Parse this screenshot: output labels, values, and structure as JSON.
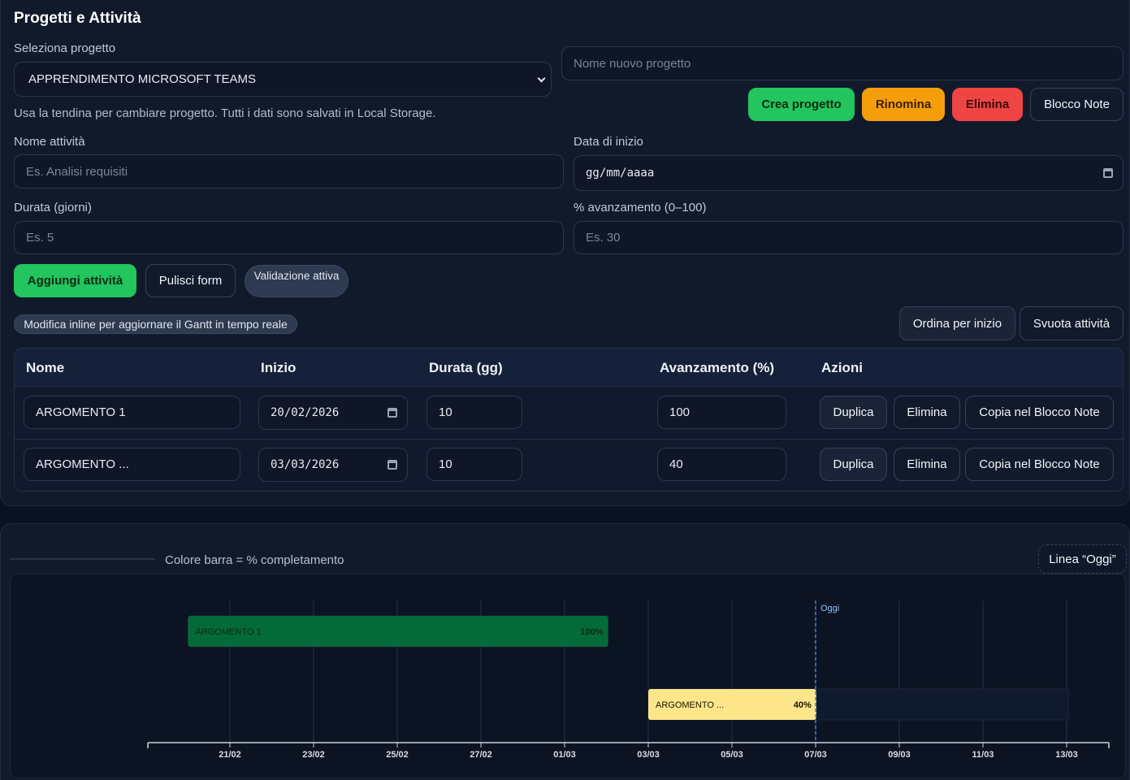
{
  "header": {
    "title": "Progetti e Attività"
  },
  "project": {
    "select_label": "Seleziona progetto",
    "selected": "APPRENDIMENTO MICROSOFT TEAMS",
    "new_name_placeholder": "Nome nuovo progetto",
    "hint": "Usa la tendina per cambiare progetto. Tutti i dati sono salvati in Local Storage.",
    "buttons": {
      "create": "Crea progetto",
      "rename": "Rinomina",
      "delete": "Elimina",
      "notes": "Blocco Note"
    }
  },
  "form": {
    "name_label": "Nome attività",
    "name_placeholder": "Es. Analisi requisiti",
    "start_label": "Data di inizio",
    "start_placeholder": "gg/mm/aaaa",
    "duration_label": "Durata (giorni)",
    "duration_placeholder": "Es. 5",
    "progress_label": "% avanzamento (0–100)",
    "progress_placeholder": "Es. 30",
    "add_button": "Aggiungi attività",
    "clear_button": "Pulisci form",
    "validation_badge": "Validazione attiva"
  },
  "toolbar": {
    "inline_hint": "Modifica inline per aggiornare il Gantt in tempo reale",
    "sort_button": "Ordina per inizio",
    "clear_tasks_button": "Svuota attività"
  },
  "table": {
    "columns": [
      "Nome",
      "Inizio",
      "Durata (gg)",
      "Avanzamento (%)",
      "Azioni"
    ],
    "rows": [
      {
        "name": "ARGOMENTO 1",
        "start": "20/02/2026",
        "duration": "10",
        "progress": "100"
      },
      {
        "name": "ARGOMENTO ...",
        "start": "03/03/2026",
        "duration": "10",
        "progress": "40"
      }
    ],
    "actions": {
      "duplicate": "Duplica",
      "delete": "Elimina",
      "copy_notes": "Copia nel Blocco Note"
    }
  },
  "gantt": {
    "legend_text": "Colore barra = % completamento",
    "today_button": "Linea “Oggi”",
    "today_label": "Oggi"
  },
  "chart_data": {
    "type": "gantt",
    "x_ticks": [
      "21/02",
      "23/02",
      "25/02",
      "27/02",
      "01/03",
      "03/03",
      "05/03",
      "07/03",
      "09/03",
      "11/03",
      "13/03"
    ],
    "today": "07/03",
    "tasks": [
      {
        "name": "ARGOMENTO 1",
        "start": "20/02",
        "end": "02/03",
        "progress": 100,
        "label": "100%",
        "color": "#046a38"
      },
      {
        "name": "ARGOMENTO ...",
        "start": "03/03",
        "end": "13/03",
        "progress": 40,
        "label": "40%",
        "color": "#fde68a"
      }
    ],
    "colors": {
      "track": "#0f1a2e",
      "grid": "#26324a",
      "today": "#3b82f6"
    }
  }
}
